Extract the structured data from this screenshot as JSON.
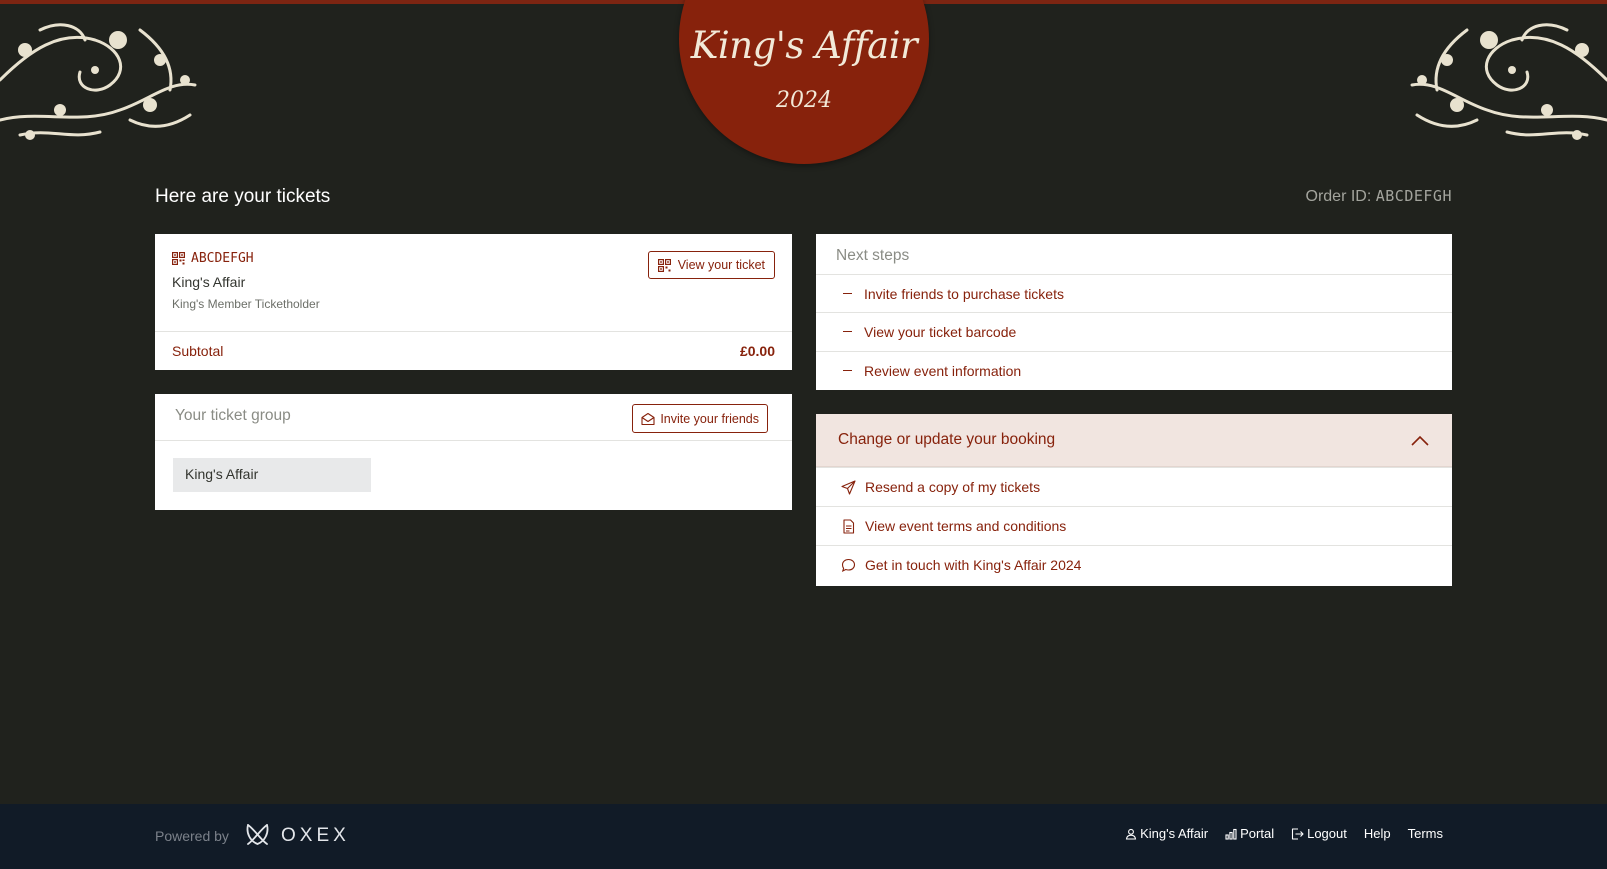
{
  "brand": {
    "name": "King's Affair",
    "year": "2024",
    "primary_color": "#87220c",
    "background_color": "#20221d"
  },
  "header": {
    "heading": "Here are your tickets",
    "order_id_label": "Order ID:",
    "order_id_value": "ABCDEFGH"
  },
  "ticket": {
    "code": "ABCDEFGH",
    "event": "King's Affair",
    "type": "King's Member Ticketholder",
    "view_button": "View your ticket",
    "subtotal_label": "Subtotal",
    "subtotal_value": "£0.00"
  },
  "group": {
    "title": "Your ticket group",
    "invite_button": "Invite your friends",
    "members": [
      "King's Affair"
    ]
  },
  "next_steps": {
    "title": "Next steps",
    "items": [
      "Invite friends to purchase tickets",
      "View your ticket barcode",
      "Review event information"
    ]
  },
  "booking": {
    "title": "Change or update your booking",
    "items": [
      {
        "label": "Resend a copy of my tickets",
        "icon": "send-icon"
      },
      {
        "label": "View event terms and conditions",
        "icon": "document-icon"
      },
      {
        "label": "Get in touch with King's Affair 2024",
        "icon": "chat-bubble-icon"
      }
    ]
  },
  "footer": {
    "powered_by": "Powered by",
    "provider": "OXEX",
    "links": [
      {
        "label": "King's Affair",
        "icon": "user-icon"
      },
      {
        "label": "Portal",
        "icon": "bar-chart-icon"
      },
      {
        "label": "Logout",
        "icon": "logout-icon"
      },
      {
        "label": "Help",
        "icon": ""
      },
      {
        "label": "Terms",
        "icon": ""
      }
    ]
  }
}
